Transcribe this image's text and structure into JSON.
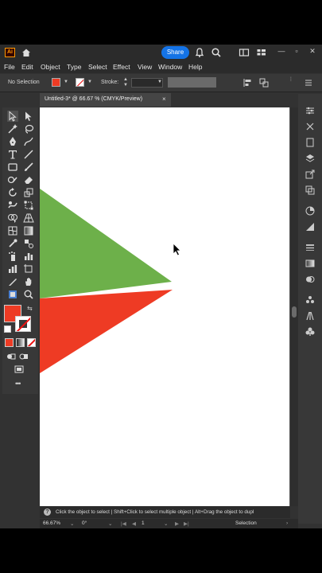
{
  "titlebar": {
    "app_logo": "Ai",
    "share_label": "Share",
    "icons": [
      "home-icon",
      "share-button",
      "bell-icon",
      "search-icon",
      "arrange-icon",
      "workspace-icon"
    ]
  },
  "menu": [
    "File",
    "Edit",
    "Object",
    "Type",
    "Select",
    "Effect",
    "View",
    "Window",
    "Help"
  ],
  "controlbar": {
    "selection_label": "No Selection",
    "stroke_label": "Stroke:",
    "fill_color": "#ee3b24"
  },
  "document": {
    "tab_title": "Untitled-3* @ 66.67 % (CMYK/Preview)",
    "close": "×"
  },
  "artwork": {
    "green_color": "#6db04a",
    "red_color": "#ee3b24"
  },
  "hint": {
    "icon": "?",
    "text": "Click the object to select  |  Shift+Click to select multiple object  |  Alt+Drag the object to dupl"
  },
  "status": {
    "zoom": "66.67%",
    "rotate": "0°",
    "artboard": "1",
    "mode": "Selection"
  },
  "tools_more": "•••"
}
